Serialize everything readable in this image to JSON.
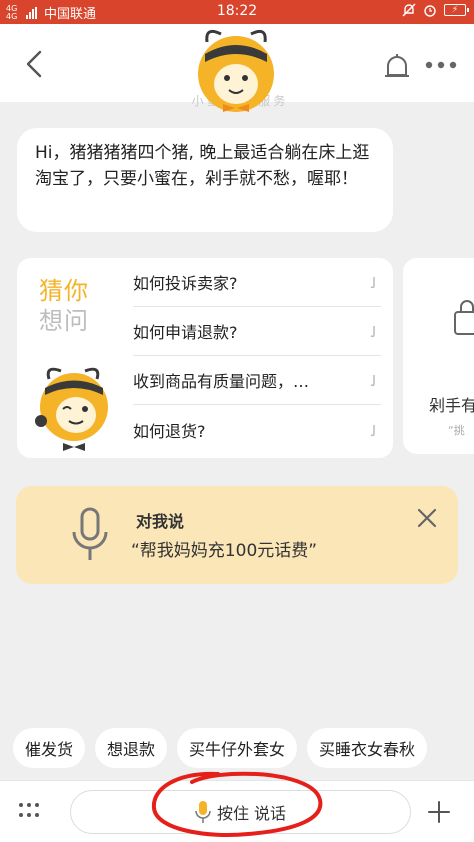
{
  "status_bar": {
    "network": "4G 4G",
    "carrier": "中国联通",
    "time": "18:22",
    "battery_icon": "battery-charging-icon"
  },
  "header": {
    "back_icon": "chevron-left-icon",
    "bell_icon": "bell-icon",
    "more_icon": "more-dots-icon",
    "faded_subtitle": "小蜜 为你服务"
  },
  "greeting": {
    "text": "Hi，猪猪猪猪四个猪, 晚上最适合躺在床上逛淘宝了，只要小蜜在，剁手就不愁，喔耶！"
  },
  "guess_card": {
    "title_line1": "猜你",
    "title_line2": "想问",
    "questions": [
      "如何投诉卖家?",
      "如何申请退款?",
      "收到商品有质量问题，…",
      "如何退货?"
    ]
  },
  "side_card": {
    "label": "剁手有",
    "sub": "“挑"
  },
  "voice_hint": {
    "title": "对我说",
    "example": "“帮我妈妈充100元话费”"
  },
  "suggestions": [
    "催发货",
    "想退款",
    "买牛仔外套女",
    "买睡衣女春秋"
  ],
  "bottom_bar": {
    "hold_to_talk": "按住 说话"
  },
  "colors": {
    "status_bar": "#d8442c",
    "accent_yellow": "#f5b328",
    "voice_card_bg": "#fbe6b8",
    "annotation_red": "#e5201b"
  }
}
